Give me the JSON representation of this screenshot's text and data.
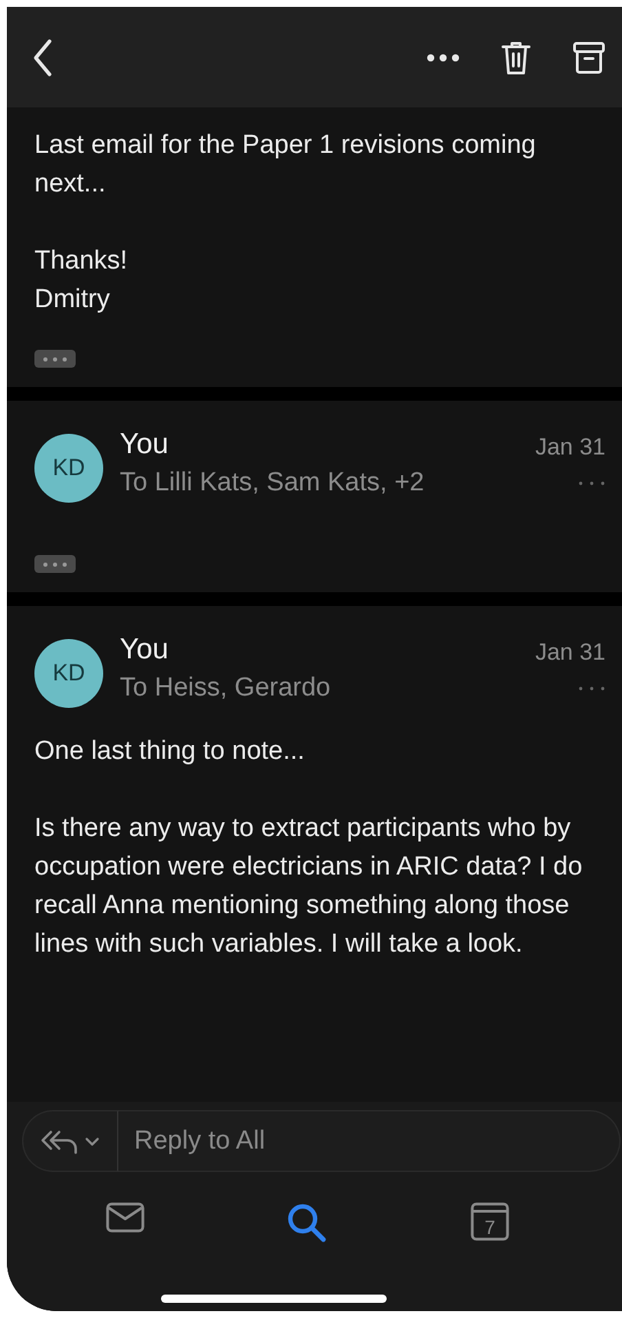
{
  "toolbar": {
    "actions": [
      {
        "kind": "back"
      },
      {
        "kind": "more"
      },
      {
        "kind": "delete"
      },
      {
        "kind": "archive"
      }
    ]
  },
  "messages": [
    {
      "kind": "body",
      "paragraphs": [
        "Last email for the Paper 1 revisions coming next...",
        "Thanks!\nDmitry"
      ],
      "trimmed": true
    },
    {
      "kind": "message",
      "avatar": {
        "initials": "KD",
        "color": "#6bbcc4"
      },
      "sender": "You",
      "recipients": "To Lilli Kats, Sam Kats, +2",
      "date": "Jan 31",
      "trimmed": true
    },
    {
      "kind": "message",
      "avatar": {
        "initials": "KD",
        "color": "#6bbcc4"
      },
      "sender": "You",
      "recipients": "To Heiss, Gerardo",
      "date": "Jan 31",
      "paragraphs": [
        "One last thing to note...",
        "Is there any way to extract participants who by occupation were electricians in ARIC data? I do recall Anna mentioning something along those lines with such variables. I will take a look."
      ],
      "trimmed": false
    }
  ],
  "reply": {
    "placeholder": "Reply to All"
  },
  "tabs": [
    {
      "kind": "mail",
      "selected": false
    },
    {
      "kind": "search",
      "selected": true
    },
    {
      "kind": "calendar",
      "selected": false,
      "day": "7"
    }
  ]
}
